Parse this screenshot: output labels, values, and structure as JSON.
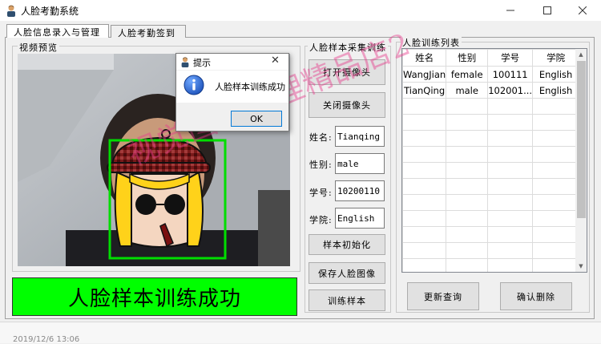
{
  "window": {
    "title": "人脸考勤系统",
    "icon": "user-avatar-icon"
  },
  "tabs": [
    {
      "label": "人脸信息录入与管理",
      "active": true
    },
    {
      "label": "人脸考勤签到",
      "active": false
    }
  ],
  "video": {
    "group_label": "视频预览"
  },
  "training": {
    "group_label": "人脸样本采集训练",
    "open_camera": "打开摄像头",
    "close_camera": "关闭摄像头",
    "fields": {
      "name_label": "姓名:",
      "name_value": "Tianqing",
      "gender_label": "性别:",
      "gender_value": "male",
      "id_label": "学号:",
      "id_value": "10200110",
      "college_label": "学院:",
      "college_value": "English"
    },
    "init_button": "样本初始化",
    "save_button": "保存人脸图像",
    "train_button": "训练样本"
  },
  "status_banner": {
    "text": "人脸样本训练成功",
    "color": "#00ff00"
  },
  "list": {
    "group_label": "人脸训练列表",
    "columns": [
      "姓名",
      "性别",
      "学号",
      "学院"
    ],
    "rows": [
      [
        "WangJian",
        "female",
        "100111",
        "English"
      ],
      [
        "TianQing",
        "male",
        "102001...",
        "English"
      ]
    ],
    "refresh_button": "更新查询",
    "delete_button": "确认删除"
  },
  "dialog": {
    "title": "提示",
    "message": "人脸样本训练成功",
    "ok_label": "OK",
    "icon": "info-icon"
  },
  "watermark": "视觉图像处理精品店2",
  "bottom_text": "2019/12/6 13:06"
}
